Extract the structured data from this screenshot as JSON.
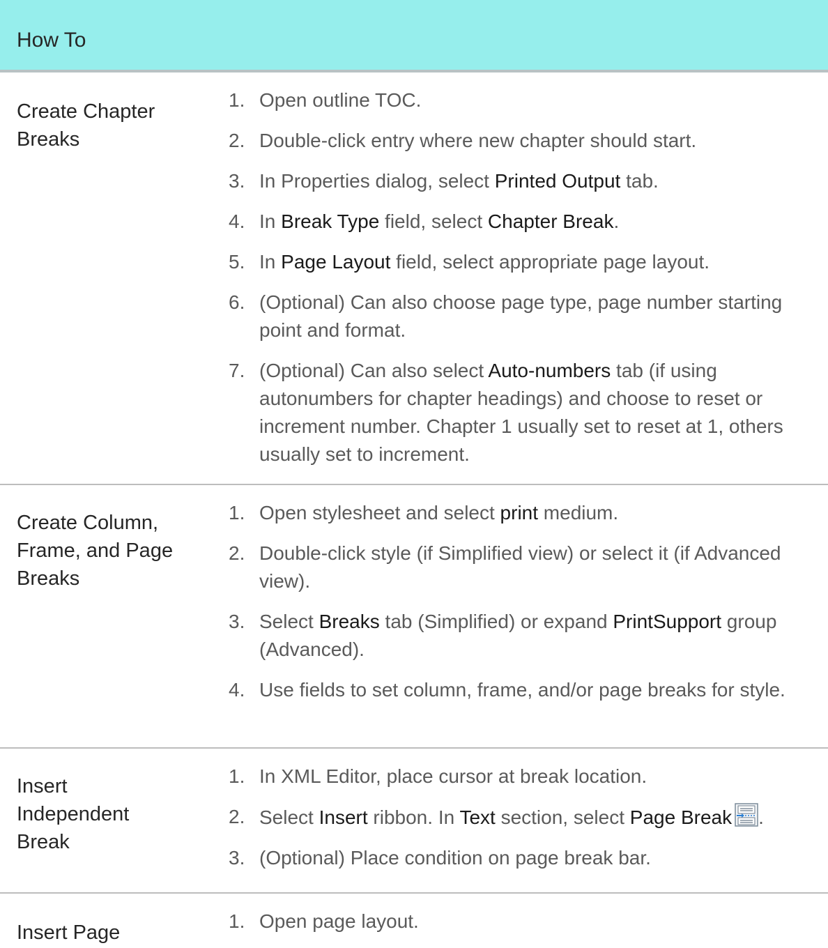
{
  "header": {
    "title": "How To"
  },
  "rows": [
    {
      "label_lines": [
        "Create Chapter",
        "Breaks"
      ],
      "steps": [
        {
          "num": "1.",
          "parts": [
            {
              "t": "Open outline TOC."
            }
          ]
        },
        {
          "num": "2.",
          "parts": [
            {
              "t": "Double-click entry where new chapter should start."
            }
          ]
        },
        {
          "num": "3.",
          "parts": [
            {
              "t": "In Properties dialog, select "
            },
            {
              "t": "Printed Output",
              "em": true
            },
            {
              "t": " tab."
            }
          ]
        },
        {
          "num": "4.",
          "parts": [
            {
              "t": "In "
            },
            {
              "t": "Break Type",
              "em": true
            },
            {
              "t": " field, select "
            },
            {
              "t": "Chapter Break",
              "em": true
            },
            {
              "t": "."
            }
          ]
        },
        {
          "num": "5.",
          "parts": [
            {
              "t": "In "
            },
            {
              "t": "Page Layout",
              "em": true
            },
            {
              "t": " field, select appropriate page layout."
            }
          ]
        },
        {
          "num": "6.",
          "parts": [
            {
              "t": "(Optional) Can also choose page type, page number starting point and format."
            }
          ]
        },
        {
          "num": "7.",
          "parts": [
            {
              "t": "(Optional) Can also select "
            },
            {
              "t": "Auto-numbers",
              "em": true
            },
            {
              "t": " tab (if using autonumbers for chapter headings) and choose to reset or increment number. Chapter 1 usually set to reset at 1, others usually set to increment."
            }
          ]
        }
      ]
    },
    {
      "label_lines": [
        "Create Column,",
        "Frame, and Page",
        "Breaks"
      ],
      "steps": [
        {
          "num": "1.",
          "parts": [
            {
              "t": "Open stylesheet and select "
            },
            {
              "t": "print",
              "em": true
            },
            {
              "t": " medium."
            }
          ]
        },
        {
          "num": "2.",
          "parts": [
            {
              "t": "Double-click style (if Simplified view) or select it (if Advanced view)."
            }
          ]
        },
        {
          "num": "3.",
          "parts": [
            {
              "t": "Select "
            },
            {
              "t": "Breaks",
              "em": true
            },
            {
              "t": " tab (Simplified) or expand "
            },
            {
              "t": "PrintSupport",
              "em": true
            },
            {
              "t": " group (Advanced)."
            }
          ]
        },
        {
          "num": "4.",
          "parts": [
            {
              "t": "Use fields to set column, frame, and/or page breaks for style."
            }
          ]
        }
      ]
    },
    {
      "label_lines": [
        "Insert",
        "Independent",
        "Break"
      ],
      "steps": [
        {
          "num": "1.",
          "parts": [
            {
              "t": "In XML Editor, place cursor at break location."
            }
          ]
        },
        {
          "num": "2.",
          "parts": [
            {
              "t": "Select "
            },
            {
              "t": "Insert",
              "em": true
            },
            {
              "t": " ribbon. In "
            },
            {
              "t": "Text",
              "em": true
            },
            {
              "t": " section, select "
            },
            {
              "t": "Page Break",
              "em": true
            },
            {
              "icon": "page-break-icon"
            },
            {
              "t": "."
            }
          ]
        },
        {
          "num": "3.",
          "parts": [
            {
              "t": "(Optional) Place condition on page break bar."
            }
          ]
        }
      ]
    },
    {
      "label_lines": [
        "Insert Page"
      ],
      "steps": [
        {
          "num": "1.",
          "parts": [
            {
              "t": "Open page layout."
            }
          ]
        }
      ]
    }
  ]
}
